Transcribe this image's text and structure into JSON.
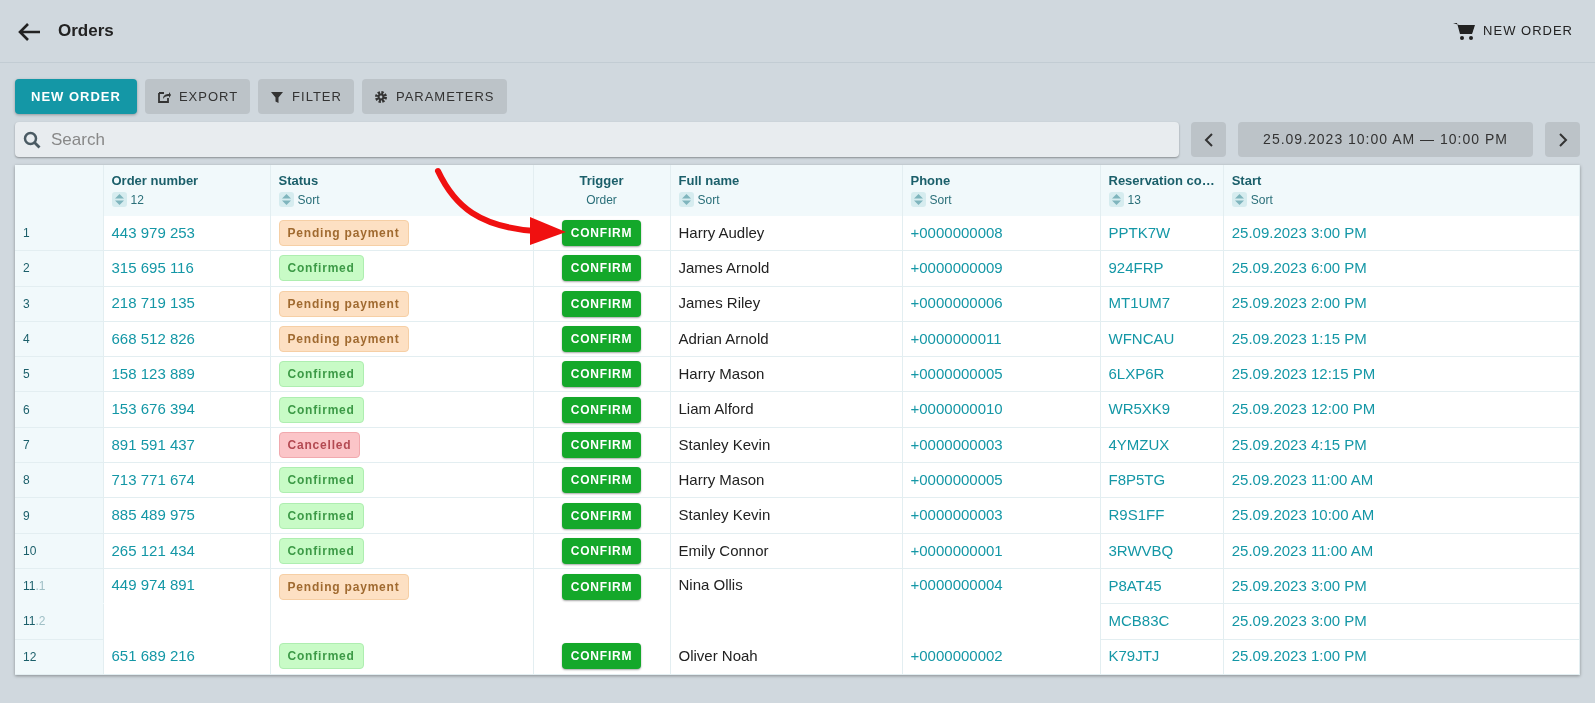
{
  "header": {
    "title": "Orders",
    "action": "NEW ORDER"
  },
  "toolbar": {
    "buttons": [
      {
        "label": "NEW ORDER",
        "kind": "primary"
      },
      {
        "label": "EXPORT",
        "kind": "export"
      },
      {
        "label": "FILTER",
        "kind": "filter"
      },
      {
        "label": "PARAMETERS",
        "kind": "settings"
      }
    ]
  },
  "search": {
    "placeholder": "Search"
  },
  "date_range": {
    "label": "25.09.2023 10:00 AM — 10:00 PM"
  },
  "table": {
    "columns": [
      {
        "title": "Order number",
        "sort": "12"
      },
      {
        "title": "Status",
        "sort": "Sort"
      },
      {
        "title": "Trigger",
        "subtitle": "Order"
      },
      {
        "title": "Full name",
        "sort": "Sort"
      },
      {
        "title": "Phone",
        "sort": "Sort"
      },
      {
        "title": "Reservation co…",
        "sort": "13"
      },
      {
        "title": "Start",
        "sort": "Sort"
      }
    ],
    "rows": [
      {
        "number": "1",
        "order": "443 979 253",
        "status": "Pending payment",
        "kind": "pending",
        "trigger": "CONFIRM",
        "name": "Harry Audley",
        "phone": "+0000000008",
        "reservations": [
          {
            "code": "PPTK7W",
            "start": "25.09.2023 3:00 PM"
          }
        ]
      },
      {
        "number": "2",
        "order": "315 695 116",
        "status": "Confirmed",
        "kind": "confirmed",
        "trigger": "CONFIRM",
        "name": "James Arnold",
        "phone": "+0000000009",
        "reservations": [
          {
            "code": "924FRP",
            "start": "25.09.2023 6:00 PM"
          }
        ]
      },
      {
        "number": "3",
        "order": "218 719 135",
        "status": "Pending payment",
        "kind": "pending",
        "trigger": "CONFIRM",
        "name": "James Riley",
        "phone": "+0000000006",
        "reservations": [
          {
            "code": "MT1UM7",
            "start": "25.09.2023 2:00 PM"
          }
        ]
      },
      {
        "number": "4",
        "order": "668 512 826",
        "status": "Pending payment",
        "kind": "pending",
        "trigger": "CONFIRM",
        "name": "Adrian Arnold",
        "phone": "+0000000011",
        "reservations": [
          {
            "code": "WFNCAU",
            "start": "25.09.2023 1:15 PM"
          }
        ]
      },
      {
        "number": "5",
        "order": "158 123 889",
        "status": "Confirmed",
        "kind": "confirmed",
        "trigger": "CONFIRM",
        "name": "Harry Mason",
        "phone": "+0000000005",
        "reservations": [
          {
            "code": "6LXP6R",
            "start": "25.09.2023 12:15 PM"
          }
        ]
      },
      {
        "number": "6",
        "order": "153 676 394",
        "status": "Confirmed",
        "kind": "confirmed",
        "trigger": "CONFIRM",
        "name": "Liam Alford",
        "phone": "+0000000010",
        "reservations": [
          {
            "code": "WR5XK9",
            "start": "25.09.2023 12:00 PM"
          }
        ]
      },
      {
        "number": "7",
        "order": "891 591 437",
        "status": "Cancelled",
        "kind": "cancelled",
        "trigger": "CONFIRM",
        "name": "Stanley Kevin",
        "phone": "+0000000003",
        "reservations": [
          {
            "code": "4YMZUX",
            "start": "25.09.2023 4:15 PM"
          }
        ]
      },
      {
        "number": "8",
        "order": "713 771 674",
        "status": "Confirmed",
        "kind": "confirmed",
        "trigger": "CONFIRM",
        "name": "Harry Mason",
        "phone": "+0000000005",
        "reservations": [
          {
            "code": "F8P5TG",
            "start": "25.09.2023 11:00 AM"
          }
        ]
      },
      {
        "number": "9",
        "order": "885 489 975",
        "status": "Confirmed",
        "kind": "confirmed",
        "trigger": "CONFIRM",
        "name": "Stanley Kevin",
        "phone": "+0000000003",
        "reservations": [
          {
            "code": "R9S1FF",
            "start": "25.09.2023 10:00 AM"
          }
        ]
      },
      {
        "number": "10",
        "order": "265 121 434",
        "status": "Confirmed",
        "kind": "confirmed",
        "trigger": "CONFIRM",
        "name": "Emily Connor",
        "phone": "+0000000001",
        "reservations": [
          {
            "code": "3RWVBQ",
            "start": "25.09.2023 11:00 AM"
          }
        ]
      },
      {
        "number": "11",
        "order": "449 974 891",
        "status": "Pending payment",
        "kind": "pending",
        "trigger": "CONFIRM",
        "name": "Nina Ollis",
        "phone": "+0000000004",
        "reservations": [
          {
            "suffix": ".1",
            "code": "P8AT45",
            "start": "25.09.2023 3:00 PM"
          },
          {
            "number": "11",
            "suffix": ".2",
            "code": "MCB83C",
            "start": "25.09.2023 3:00 PM"
          }
        ]
      },
      {
        "number": "12",
        "order": "651 689 216",
        "status": "Confirmed",
        "kind": "confirmed",
        "trigger": "CONFIRM",
        "name": "Oliver Noah",
        "phone": "+0000000002",
        "reservations": [
          {
            "code": "K79JTJ",
            "start": "25.09.2023 1:00 PM"
          }
        ]
      }
    ]
  }
}
